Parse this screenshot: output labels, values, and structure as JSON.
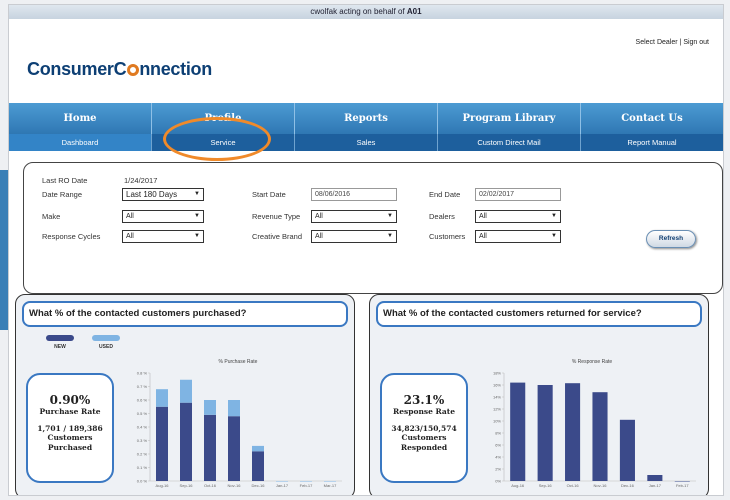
{
  "top_bar": {
    "acting_prefix": "cwolfak acting on behalf of ",
    "acting_account": "A01"
  },
  "header": {
    "logo_part1": "Consumer",
    "logo_part2": "nnection",
    "select_dealer": "Select Dealer",
    "separator": "|",
    "sign_out": "Sign out"
  },
  "main_nav": [
    "Home",
    "Profile",
    "Reports",
    "Program Library",
    "Contact Us"
  ],
  "sub_nav": [
    "Dashboard",
    "Service",
    "Sales",
    "Custom Direct Mail",
    "Report Manual"
  ],
  "filters": {
    "last_ro_label": "Last RO Date",
    "last_ro_value": "1/24/2017",
    "date_range_label": "Date Range",
    "date_range_value": "Last 180 Days",
    "make_label": "Make",
    "make_value": "All",
    "response_cycles_label": "Response Cycles",
    "response_cycles_value": "All",
    "start_date_label": "Start Date",
    "start_date_value": "08/06/2016",
    "revenue_type_label": "Revenue Type",
    "revenue_type_value": "All",
    "creative_brand_label": "Creative Brand",
    "creative_brand_value": "All",
    "end_date_label": "End Date",
    "end_date_value": "02/02/2017",
    "dealers_label": "Dealers",
    "dealers_value": "All",
    "customers_label": "Customers",
    "customers_value": "All",
    "refresh_label": "Refresh"
  },
  "purchase_panel": {
    "question": "What % of the contacted customers purchased?",
    "legend": [
      "NEW",
      "USED"
    ],
    "rate": "0.90%",
    "rate_label": "Purchase Rate",
    "fraction": "1,701 / 189,386",
    "count_label_1": "Customers",
    "count_label_2": "Purchased"
  },
  "service_panel": {
    "question": "What % of the contacted customers returned for service?",
    "rate": "23.1%",
    "rate_label": "Response Rate",
    "fraction": "34,823/150,574",
    "count_label_1": "Customers",
    "count_label_2": "Responded"
  },
  "colors": {
    "nav_blue": "#2f77b3",
    "new_series": "#3b4a8a",
    "used_series": "#7fb4e3",
    "highlight": "#f08a2a"
  },
  "chart_data": [
    {
      "type": "bar",
      "title": "% Purchase Rate",
      "categories": [
        "Aug-16",
        "Sep-16",
        "Oct-16",
        "Nov-16",
        "Dec-16",
        "Jan-17",
        "Feb-17",
        "Mar-17"
      ],
      "series": [
        {
          "name": "NEW",
          "values": [
            0.55,
            0.58,
            0.49,
            0.48,
            0.22,
            0.0,
            0.0,
            0.0
          ]
        },
        {
          "name": "USED",
          "values": [
            0.13,
            0.17,
            0.11,
            0.12,
            0.04,
            0.0,
            0.0,
            0.0
          ]
        }
      ],
      "stacked": true,
      "y_ticks": [
        "0.0 %",
        "0.1 %",
        "0.2 %",
        "0.3 %",
        "0.4 %",
        "0.5 %",
        "0.6 %",
        "0.7 %",
        "0.8 %"
      ],
      "ylim": [
        0,
        0.8
      ],
      "grid": false
    },
    {
      "type": "bar",
      "title": "% Response Rate",
      "categories": [
        "Aug-16",
        "Sep-16",
        "Oct-16",
        "Nov-16",
        "Dec-16",
        "Jan-17",
        "Feb-17"
      ],
      "series": [
        {
          "values": [
            16.4,
            16.0,
            16.3,
            14.8,
            10.2,
            1.0,
            0.0
          ]
        }
      ],
      "y_ticks": [
        "0%",
        "2%",
        "4%",
        "6%",
        "8%",
        "10%",
        "12%",
        "14%",
        "16%",
        "18%"
      ],
      "ylim": [
        0,
        18
      ],
      "grid": false
    }
  ]
}
